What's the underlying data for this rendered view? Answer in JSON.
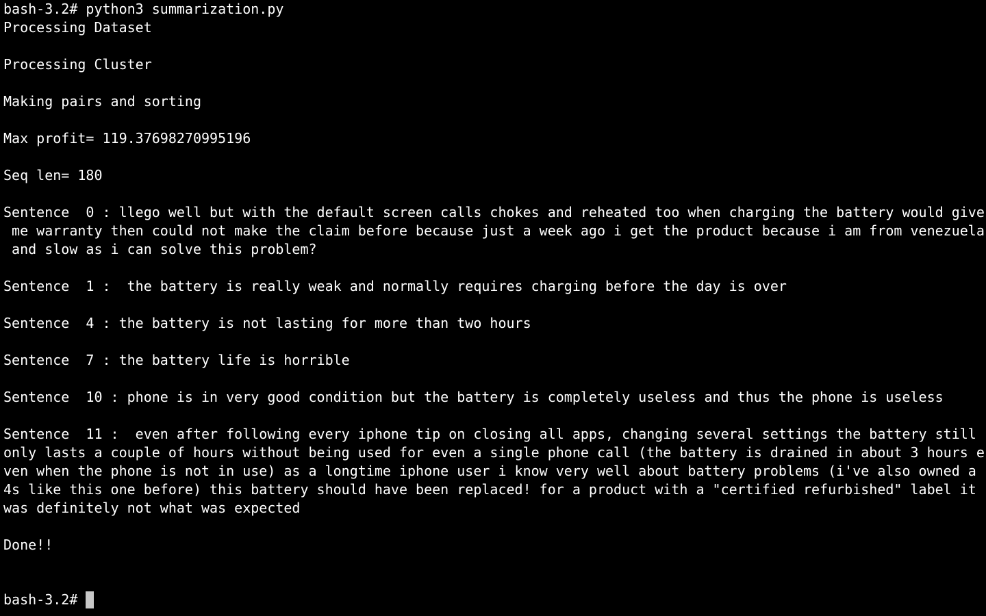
{
  "terminal": {
    "prompt": "bash-3.2#",
    "lines": [
      "bash-3.2# python3 summarization.py",
      "Processing Dataset",
      "",
      "Processing Cluster",
      "",
      "Making pairs and sorting",
      "",
      "Max profit= 119.37698270995196",
      "",
      "Seq len= 180",
      "",
      "Sentence  0 : llego well but with the default screen calls chokes and reheated too when charging the battery would give",
      " me warranty then could not make the claim before because just a week ago i get the product because i am from venezuela",
      " and slow as i can solve this problem?",
      "",
      "Sentence  1 :  the battery is really weak and normally requires charging before the day is over",
      "",
      "Sentence  4 : the battery is not lasting for more than two hours",
      "",
      "Sentence  7 : the battery life is horrible",
      "",
      "Sentence  10 : phone is in very good condition but the battery is completely useless and thus the phone is useless",
      "",
      "Sentence  11 :  even after following every iphone tip on closing all apps, changing several settings the battery still",
      "only lasts a couple of hours without being used for even a single phone call (the battery is drained in about 3 hours e",
      "ven when the phone is not in use) as a longtime iphone user i know very well about battery problems (i've also owned a",
      "4s like this one before) this battery should have been replaced! for a product with a \"certified refurbished\" label it",
      "was definitely not what was expected",
      "",
      "Done!!"
    ]
  }
}
